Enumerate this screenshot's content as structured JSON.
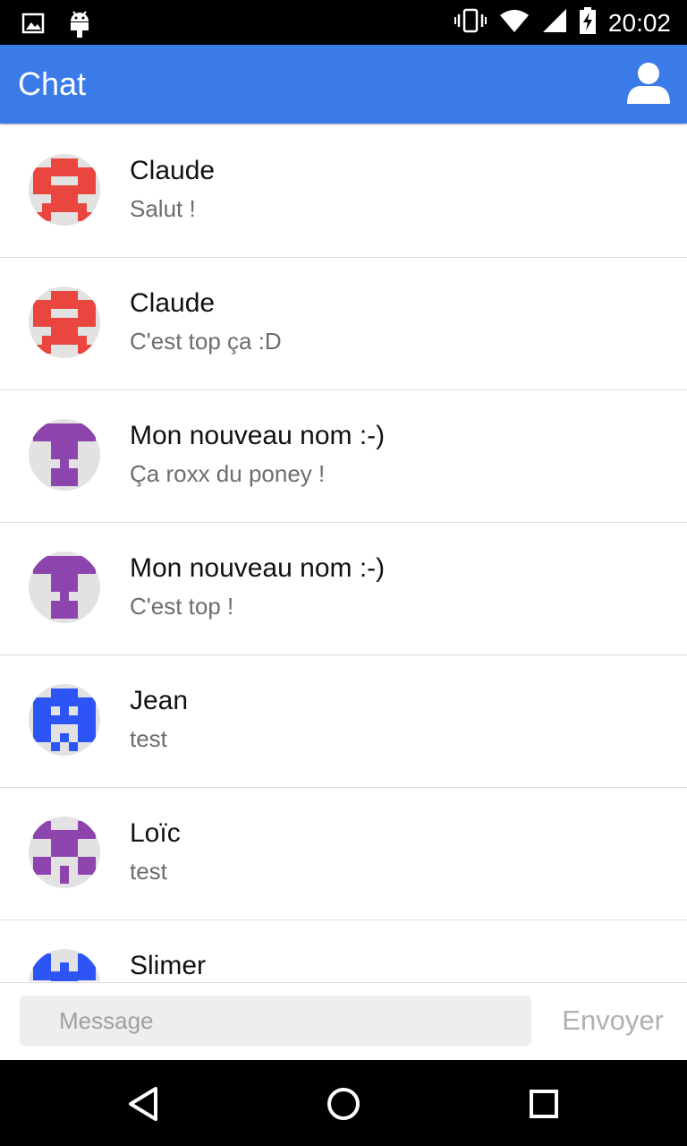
{
  "status_bar": {
    "time": "20:02",
    "icons": [
      "image-icon",
      "android-icon",
      "vibrate-icon",
      "wifi-icon",
      "signal-icon",
      "battery-charging-icon"
    ]
  },
  "app_bar": {
    "title": "Chat",
    "profile_icon": "person-icon"
  },
  "messages": [
    {
      "name": "Claude",
      "text": "Salut !",
      "avatar_color": "#e8463f"
    },
    {
      "name": "Claude",
      "text": "C'est top ça :D",
      "avatar_color": "#e8463f"
    },
    {
      "name": "Mon nouveau nom :-)",
      "text": "Ça roxx du poney !",
      "avatar_color": "#8e44ad"
    },
    {
      "name": "Mon nouveau nom :-)",
      "text": "C'est top !",
      "avatar_color": "#8e44ad"
    },
    {
      "name": "Jean",
      "text": "test",
      "avatar_color": "#2d55f5"
    },
    {
      "name": "Loïc",
      "text": "test",
      "avatar_color": "#8e44ad"
    },
    {
      "name": "Slimer",
      "text": "",
      "avatar_color": "#2d55f5"
    }
  ],
  "composer": {
    "placeholder": "Message",
    "value": "",
    "send_label": "Envoyer"
  },
  "nav_bar": {
    "icons": [
      "back-icon",
      "home-icon",
      "recents-icon"
    ]
  }
}
